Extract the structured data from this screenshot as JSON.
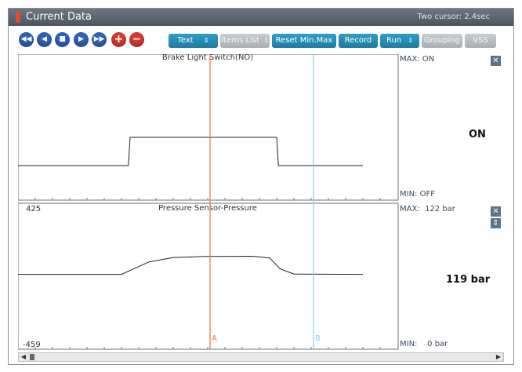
{
  "window": {
    "title": "Current Data",
    "cursor_info": "Two cursor: 2.4sec"
  },
  "toolbar": {
    "nav_buttons": [
      {
        "name": "rewind-button",
        "glyph": "◀◀"
      },
      {
        "name": "back-button",
        "glyph": "◀"
      },
      {
        "name": "stop-button",
        "glyph": "■"
      },
      {
        "name": "play-button",
        "glyph": "▶"
      },
      {
        "name": "fast-forward-button",
        "glyph": "▶▶"
      },
      {
        "name": "add-button",
        "glyph": "+"
      },
      {
        "name": "remove-button",
        "glyph": "−"
      }
    ],
    "text_label": "Text",
    "items_list_label": "Items List",
    "reset_label": "Reset Min.Max",
    "record_label": "Record",
    "run_label": "Run",
    "grouping_label": "Grouping",
    "vss_label": "VSS",
    "dropdown_glyph": "⇕"
  },
  "cursors": {
    "a_label": "A",
    "b_label": "B",
    "a_color": "#e8734a",
    "b_color": "#7fd4e0"
  },
  "chart_data": [
    {
      "type": "line",
      "title": "Brake Light Switch(NO)",
      "max_label": "MAX:",
      "max_value": "ON",
      "min_label": "MIN:",
      "min_value": "OFF",
      "current_value": "ON",
      "states": [
        "OFF",
        "ON"
      ],
      "series": [
        {
          "points": [
            [
              0,
              0
            ],
            [
              0.32,
              0
            ],
            [
              0.325,
              1
            ],
            [
              0.75,
              1
            ],
            [
              0.755,
              0
            ],
            [
              1,
              0
            ]
          ]
        }
      ]
    },
    {
      "type": "line",
      "title": "Pressure Sensor-Pressure",
      "ylim": [
        -459,
        425
      ],
      "y_max_tick": "425",
      "y_min_tick": "-459",
      "max_label": "MAX:",
      "max_value": "122 bar",
      "min_label": "MIN:",
      "min_value": "0 bar",
      "current_value": "119 bar",
      "series": [
        {
          "points": [
            [
              0,
              0
            ],
            [
              0.3,
              0
            ],
            [
              0.38,
              80
            ],
            [
              0.45,
              108
            ],
            [
              0.55,
              115
            ],
            [
              0.68,
              116
            ],
            [
              0.73,
              105
            ],
            [
              0.76,
              35
            ],
            [
              0.8,
              2
            ],
            [
              1,
              0
            ]
          ]
        }
      ]
    }
  ],
  "colors": {
    "trace": "#222222",
    "grid_tick": "#777777",
    "toolbar_blue": "#2f61b8",
    "toolbar_teal": "#1f88b0"
  }
}
